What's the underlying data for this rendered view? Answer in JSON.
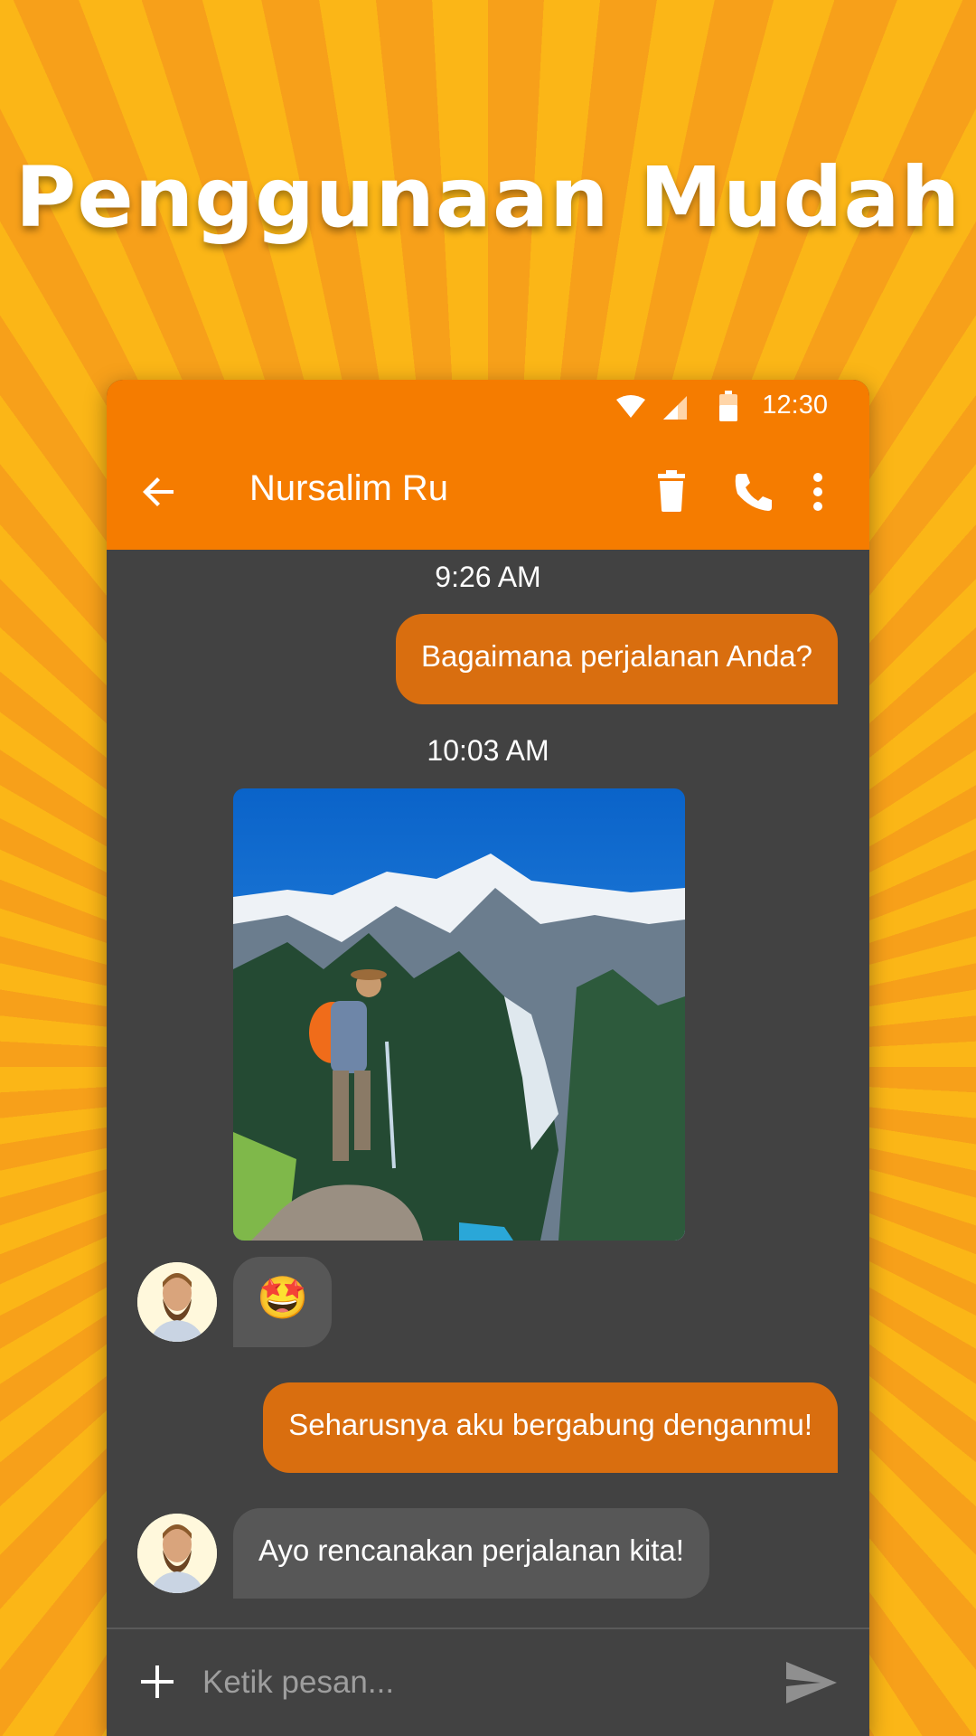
{
  "headline": "Penggunaan Mudah",
  "status_bar": {
    "time": "12:30",
    "icons": [
      "wifi-icon",
      "cellular-signal-icon",
      "battery-icon"
    ]
  },
  "app_bar": {
    "contact_name": "Nursalim Ru",
    "actions": [
      "back-arrow-icon",
      "delete-icon",
      "phone-icon",
      "more-vert-icon"
    ]
  },
  "messages": [
    {
      "type": "timestamp",
      "text": "9:26 AM"
    },
    {
      "type": "outgoing",
      "text": "Bagaimana perjalanan Anda?"
    },
    {
      "type": "timestamp",
      "text": "10:03 AM"
    },
    {
      "type": "incoming-image",
      "description": "hiker photo"
    },
    {
      "type": "incoming",
      "text": "🤩"
    },
    {
      "type": "outgoing",
      "text": "Seharusnya aku bergabung denganmu!"
    },
    {
      "type": "incoming",
      "text": "Ayo rencanakan perjalanan kita!"
    }
  ],
  "composer": {
    "placeholder": "Ketik pesan..."
  },
  "colors": {
    "accent": "#f57c00",
    "outgoing_bubble": "#d96e0f",
    "incoming_bubble": "#575757",
    "chat_background": "#424242"
  }
}
